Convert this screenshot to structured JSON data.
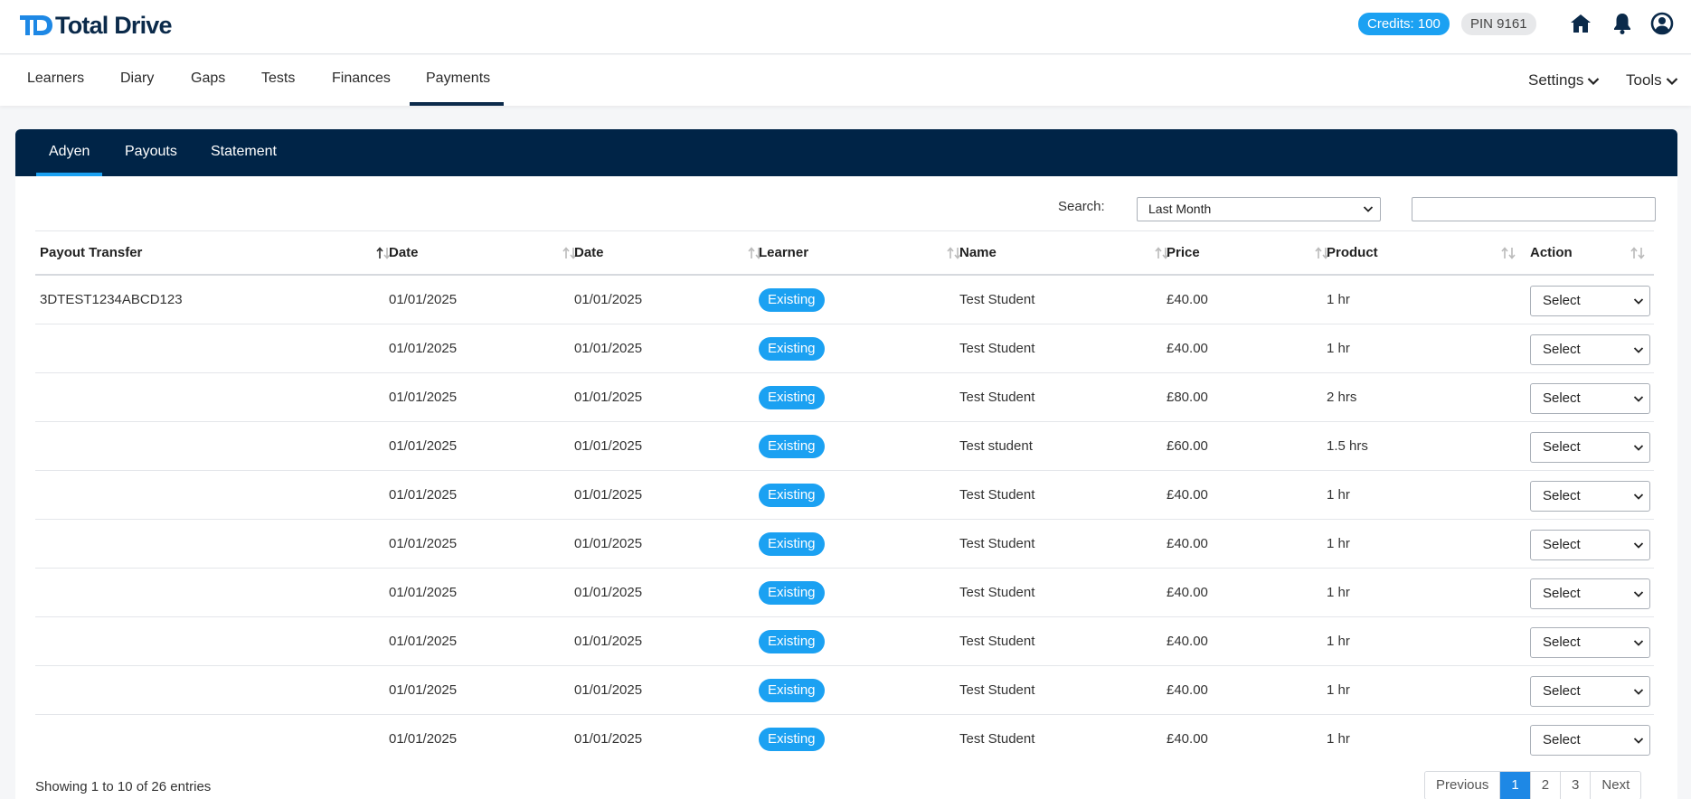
{
  "brand": {
    "name": "Total Drive",
    "mark": "TD"
  },
  "header": {
    "credits": "Credits: 100",
    "pin": "PIN 9161"
  },
  "nav": {
    "items": [
      "Learners",
      "Diary",
      "Gaps",
      "Tests",
      "Finances",
      "Payments"
    ],
    "active": "Payments",
    "settings": "Settings",
    "tools": "Tools"
  },
  "subtabs": {
    "items": [
      "Adyen",
      "Payouts",
      "Statement"
    ],
    "active": "Adyen"
  },
  "filters": {
    "search_label": "Search:",
    "period": "Last Month",
    "search_value": ""
  },
  "table": {
    "columns": [
      "Payout Transfer",
      "Date",
      "Date",
      "Learner",
      "Name",
      "Price",
      "Product",
      "Action"
    ],
    "rows": [
      {
        "payout": "3DTEST1234ABCD123",
        "date1": "01/01/2025",
        "date2": "01/01/2025",
        "learner": "Existing",
        "name": "Test Student",
        "price": "£40.00",
        "product": "1 hr",
        "action": "Select"
      },
      {
        "payout": "",
        "date1": "01/01/2025",
        "date2": "01/01/2025",
        "learner": "Existing",
        "name": "Test Student",
        "price": "£40.00",
        "product": "1 hr",
        "action": "Select"
      },
      {
        "payout": "",
        "date1": "01/01/2025",
        "date2": "01/01/2025",
        "learner": "Existing",
        "name": "Test Student",
        "price": "£80.00",
        "product": "2 hrs",
        "action": "Select"
      },
      {
        "payout": "",
        "date1": "01/01/2025",
        "date2": "01/01/2025",
        "learner": "Existing",
        "name": "Test student",
        "price": "£60.00",
        "product": "1.5 hrs",
        "action": "Select"
      },
      {
        "payout": "",
        "date1": "01/01/2025",
        "date2": "01/01/2025",
        "learner": "Existing",
        "name": "Test Student",
        "price": "£40.00",
        "product": "1 hr",
        "action": "Select"
      },
      {
        "payout": "",
        "date1": "01/01/2025",
        "date2": "01/01/2025",
        "learner": "Existing",
        "name": "Test Student",
        "price": "£40.00",
        "product": "1 hr",
        "action": "Select"
      },
      {
        "payout": "",
        "date1": "01/01/2025",
        "date2": "01/01/2025",
        "learner": "Existing",
        "name": "Test Student",
        "price": "£40.00",
        "product": "1 hr",
        "action": "Select"
      },
      {
        "payout": "",
        "date1": "01/01/2025",
        "date2": "01/01/2025",
        "learner": "Existing",
        "name": "Test Student",
        "price": "£40.00",
        "product": "1 hr",
        "action": "Select"
      },
      {
        "payout": "",
        "date1": "01/01/2025",
        "date2": "01/01/2025",
        "learner": "Existing",
        "name": "Test Student",
        "price": "£40.00",
        "product": "1 hr",
        "action": "Select"
      },
      {
        "payout": "",
        "date1": "01/01/2025",
        "date2": "01/01/2025",
        "learner": "Existing",
        "name": "Test Student",
        "price": "£40.00",
        "product": "1 hr",
        "action": "Select"
      }
    ]
  },
  "footer": {
    "showing": "Showing 1 to 10 of 26 entries",
    "pagination": [
      "Previous",
      "1",
      "2",
      "3",
      "Next"
    ],
    "current_page": "1"
  },
  "icons": {
    "home": "home-icon",
    "bell": "bell-icon",
    "user": "user-circle-icon"
  },
  "colors": {
    "navy": "#002447",
    "accent": "#1ba1f2",
    "page_active": "#1e88e5"
  }
}
